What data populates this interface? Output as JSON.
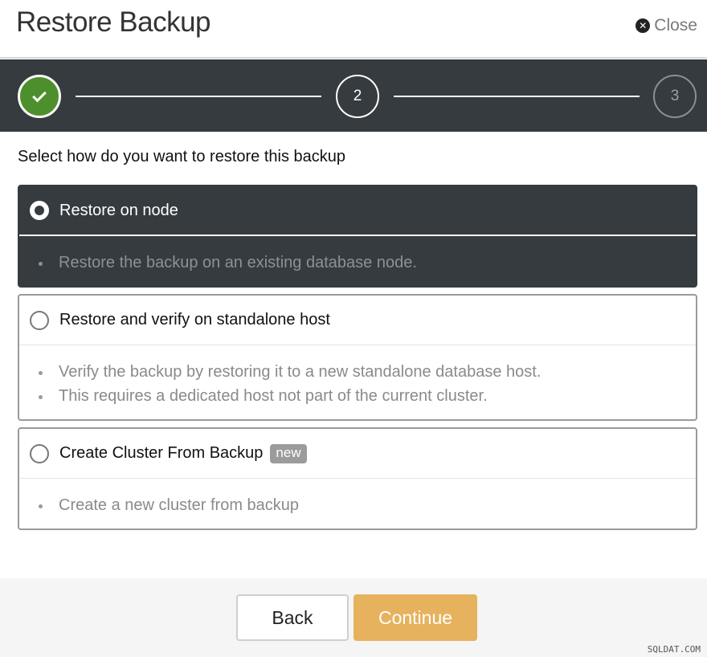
{
  "dialog": {
    "title": "Restore Backup",
    "close_label": "Close"
  },
  "stepper": {
    "steps": [
      {
        "label": "",
        "state": "done"
      },
      {
        "label": "2",
        "state": "active"
      },
      {
        "label": "3",
        "state": "pending"
      }
    ]
  },
  "prompt": "Select how do you want to restore this backup",
  "options": [
    {
      "label": "Restore on node",
      "selected": true,
      "badge": "",
      "bullets": [
        "Restore the backup on an existing database node."
      ]
    },
    {
      "label": "Restore and verify on standalone host",
      "selected": false,
      "badge": "",
      "bullets": [
        "Verify the backup by restoring it to a new standalone database host.",
        "This requires a dedicated host not part of the current cluster."
      ]
    },
    {
      "label": "Create Cluster From Backup",
      "selected": false,
      "badge": "new",
      "bullets": [
        "Create a new cluster from backup"
      ]
    }
  ],
  "footer": {
    "back_label": "Back",
    "continue_label": "Continue"
  },
  "watermark": "SQLDAT.COM",
  "colors": {
    "dark_bg": "#353b3f",
    "step_done": "#4d8f2c",
    "continue_button": "#e7b25d"
  }
}
